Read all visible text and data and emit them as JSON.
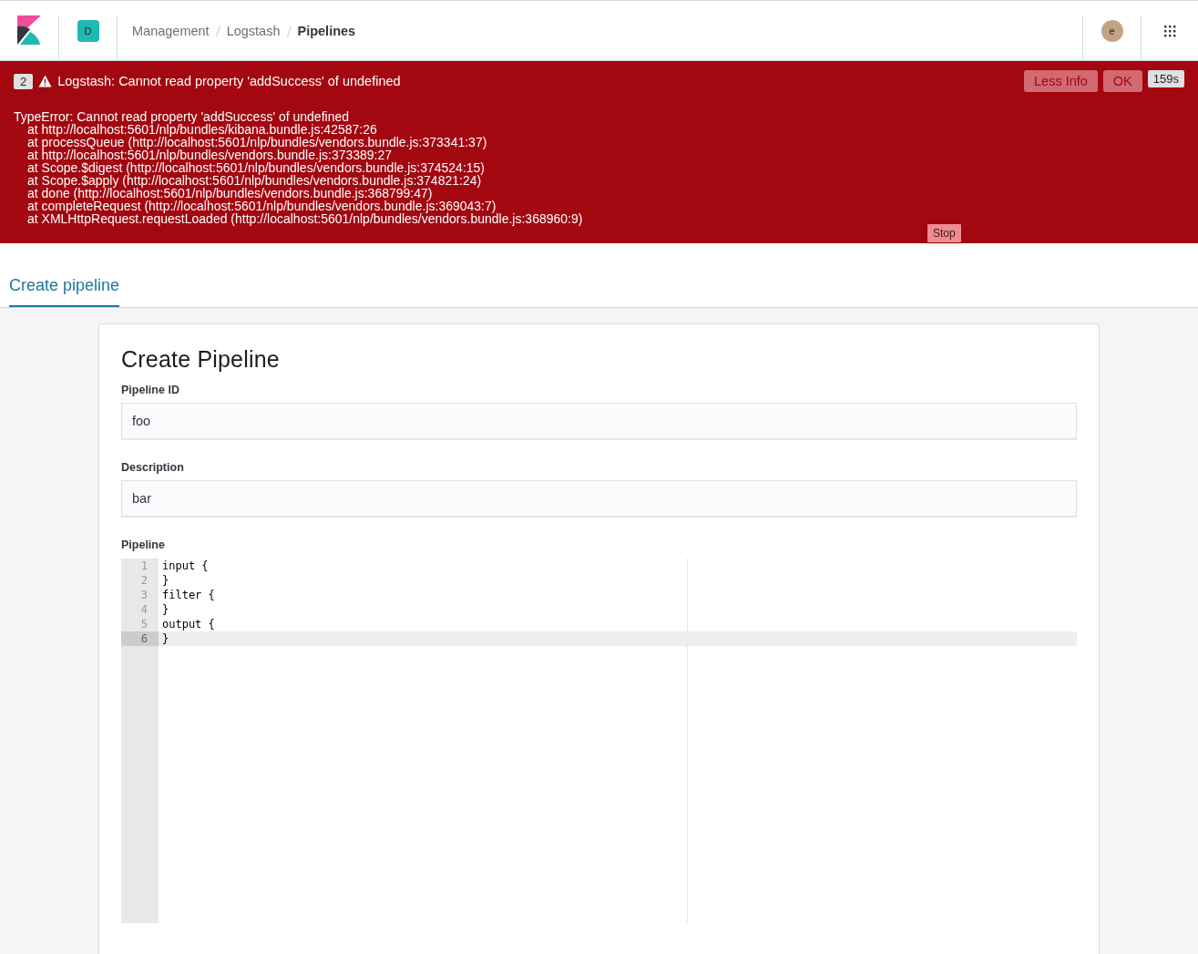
{
  "header": {
    "space_badge": "D",
    "breadcrumbs": [
      {
        "label": "Management",
        "current": false
      },
      {
        "label": "Logstash",
        "current": false
      },
      {
        "label": "Pipelines",
        "current": true
      }
    ],
    "avatar": "e"
  },
  "toast": {
    "count": "2",
    "title": "Logstash: Cannot read property 'addSuccess' of undefined",
    "buttons": [
      "Less Info",
      "OK"
    ],
    "timer": "159s",
    "details": [
      "TypeError: Cannot read property 'addSuccess' of undefined",
      "at http://localhost:5601/nlp/bundles/kibana.bundle.js:42587:26",
      "at processQueue (http://localhost:5601/nlp/bundles/vendors.bundle.js:373341:37)",
      "at http://localhost:5601/nlp/bundles/vendors.bundle.js:373389:27",
      "at Scope.$digest (http://localhost:5601/nlp/bundles/vendors.bundle.js:374524:15)",
      "at Scope.$apply (http://localhost:5601/nlp/bundles/vendors.bundle.js:374821:24)",
      "at done (http://localhost:5601/nlp/bundles/vendors.bundle.js:368799:47)",
      "at completeRequest (http://localhost:5601/nlp/bundles/vendors.bundle.js:369043:7)",
      "at XMLHttpRequest.requestLoaded (http://localhost:5601/nlp/bundles/vendors.bundle.js:368960:9)"
    ],
    "stop_button": "Stop"
  },
  "tabs": [
    {
      "label": "Create pipeline",
      "selected": true
    }
  ],
  "form": {
    "title": "Create Pipeline",
    "fields": [
      {
        "label": "Pipeline ID",
        "value": "foo"
      },
      {
        "label": "Description",
        "value": "bar"
      }
    ],
    "editor": {
      "label": "Pipeline",
      "lines": [
        {
          "number": "1",
          "text": "input {",
          "active": false
        },
        {
          "number": "2",
          "text": "}",
          "active": false
        },
        {
          "number": "3",
          "text": "filter {",
          "active": false
        },
        {
          "number": "4",
          "text": "}",
          "active": false
        },
        {
          "number": "5",
          "text": "output {",
          "active": false
        },
        {
          "number": "6",
          "text": "}",
          "active": true
        }
      ]
    }
  }
}
